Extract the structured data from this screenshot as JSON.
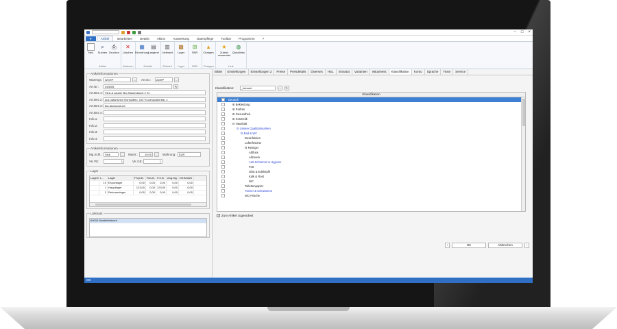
{
  "menu": {
    "file_label": "",
    "tabs": [
      "Artikel",
      "Bearbeiten",
      "Details",
      "Aktion",
      "Auswertung",
      "Datenpflege",
      "Toolbar",
      "Programme",
      "?"
    ]
  },
  "ribbon": {
    "groups": [
      {
        "label": "Artikel",
        "buttons": [
          {
            "label": "Neu",
            "icon": "new-icon"
          },
          {
            "label": "Suchen",
            "icon": "search-icon"
          },
          {
            "label": "Drucken",
            "icon": "print-icon"
          }
        ]
      },
      {
        "label": "Aktionen",
        "buttons": [
          {
            "label": "Löschen",
            "icon": "delete-icon"
          }
        ]
      },
      {
        "label": "Details",
        "buttons": [
          {
            "label": "Einordnung",
            "icon": "classify-icon"
          },
          {
            "label": "Langtext",
            "icon": "document-icon"
          }
        ]
      },
      {
        "label": "Einkauf",
        "buttons": [
          {
            "label": "Lieferant",
            "icon": "supplier-icon"
          }
        ]
      },
      {
        "label": "Lager",
        "buttons": [
          {
            "label": "Lager",
            "icon": "warehouse-icon"
          }
        ]
      },
      {
        "label": "SNR",
        "buttons": [
          {
            "label": "SNR",
            "icon": "serial-icon"
          }
        ]
      },
      {
        "label": "Chargen",
        "buttons": [
          {
            "label": "Chargen",
            "icon": "batch-icon"
          }
        ]
      },
      {
        "label": "Link",
        "buttons": [
          {
            "label": "Zuletzt verwendet",
            "icon": "star-icon"
          },
          {
            "label": "Quicklinks",
            "icon": "globe-icon"
          }
        ]
      }
    ]
  },
  "artikel": {
    "legend": "Artikelinformationen",
    "warengr_label": "Warengr.:",
    "warengr_value": "WGRP",
    "art_gr_label": "Art.Gr.:",
    "art_gr_value": "AGRP",
    "artnr_label": "Art.Nr.:",
    "artnr_value": "043005",
    "bez_rows": [
      {
        "label": "Art.Bez.1:",
        "value": "Flink & sauber Bio Allzwecktuch 2 St."
      },
      {
        "label": "Art.Bez.2:",
        "value": "aus natürlichen Rohstoffen, 100 % kompostierbar, c"
      },
      {
        "label": "Art.Bez.3:",
        "value": "Bio Allzwecktuch"
      },
      {
        "label": "Art.Bez.4:",
        "value": ""
      },
      {
        "label": "Info.1:",
        "value": ""
      },
      {
        "label": "Info.2:",
        "value": ""
      },
      {
        "label": "Info.3:",
        "value": ""
      },
      {
        "label": "Info.4:",
        "value": ""
      }
    ]
  },
  "preis": {
    "legend": "Artikelinformationen",
    "mg_label": "Mg.Schl.:",
    "mg_value": "Stck",
    "mwst_label": "MwSt.:",
    "mwst_value": "19,00",
    "waehrung_label": "Währung:",
    "waehrung_value": "EUR",
    "vkpe_label": "VK PE:",
    "vkpe_value": "1",
    "vkge_label": "VK GE:",
    "vkge_value": "1"
  },
  "lager": {
    "legend": "Lager",
    "headers": [
      "Lagerfo",
      "L...",
      "Lager",
      "Phys.B.",
      "Res.B.",
      "Fre.B.",
      "Ang.Mg.",
      "Dif.Bestell"
    ],
    "rows": [
      [
        "",
        "19",
        "Exportlager",
        "0,00",
        "0,00",
        "0,00",
        "0,00",
        "0,00"
      ],
      [
        "",
        "1",
        "Hauptlager",
        "123,00",
        "0,00",
        "123,00",
        "0,00",
        "0,00"
      ],
      [
        "",
        "2",
        "Retourenlager",
        "0,00",
        "0,00",
        "0,00",
        "0,00",
        "0,00"
      ]
    ]
  },
  "lieferant": {
    "legend": "Lieferant",
    "value": "60000 Musterlieferant"
  },
  "detail_tabs": [
    "Bilder",
    "Einstellungen",
    "Einstellungen 2",
    "Preise",
    "Preisdetails",
    "Diverses",
    "HSL",
    "Intrastat",
    "Varianten",
    "eBusiness",
    "Klassifikation",
    "Konto",
    "Sprache",
    "Texte",
    "Service"
  ],
  "active_tab": "Klassifikation",
  "klassifikation": {
    "label": "Klassifikation:",
    "value": "_Intranet",
    "column_header": "Klassifikation",
    "nodes": [
      {
        "text": "Deutsch",
        "indent": 0,
        "sel": true
      },
      {
        "text": "⊞ Bekleidung",
        "indent": 1
      },
      {
        "text": "⊞ Parfüm",
        "indent": 1
      },
      {
        "text": "⊞ Gesundheit",
        "indent": 1
      },
      {
        "text": "⊞ Kosmetik",
        "indent": 1
      },
      {
        "text": "⊟ Haushalt",
        "indent": 1
      },
      {
        "text": "⊟ Unsere Qualitätsmarken",
        "indent": 2,
        "blue": true
      },
      {
        "text": "⊟ Bad & WC",
        "indent": 3,
        "blue": true
      },
      {
        "text": "Desinfektion",
        "indent": 4
      },
      {
        "text": "Lufterfrischer",
        "indent": 4
      },
      {
        "text": "⊟ Reiniger",
        "indent": 4
      },
      {
        "text": "Abfluss",
        "indent": 5
      },
      {
        "text": "Allzweck",
        "indent": 5
      },
      {
        "text": "Anti-Schimmel & Hygiene",
        "indent": 5,
        "blue": true
      },
      {
        "text": "Fett",
        "indent": 5
      },
      {
        "text": "Glas & Edelstahl",
        "indent": 5
      },
      {
        "text": "Kalk & Rost",
        "indent": 5
      },
      {
        "text": "WC",
        "indent": 5
      },
      {
        "text": "Toilettenpapier",
        "indent": 4
      },
      {
        "text": "Tücher & Schwämme",
        "indent": 4,
        "blue": true
      },
      {
        "text": "WC-Frische",
        "indent": 4
      }
    ],
    "checkbox_label": "Zum Artikel zugeordnet"
  },
  "buttons": {
    "ok": "OK",
    "cancel": "Abbrechen"
  },
  "status": {
    "text": "OK"
  },
  "colors": {
    "accent": "#2f6fc4",
    "selection": "#3c7fd4",
    "link": "#2b45d8"
  }
}
